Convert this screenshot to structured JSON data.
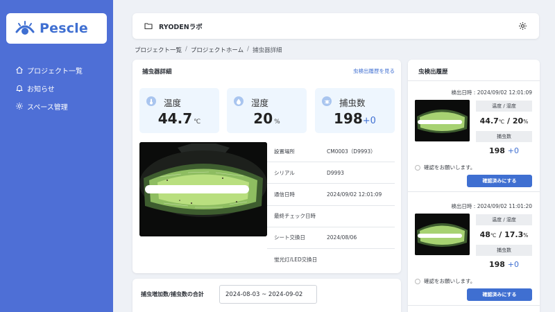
{
  "app": {
    "logo_text": "Pescle",
    "brand_color": "#4e6fd6",
    "accent_color": "#3f6fd1"
  },
  "sidebar": {
    "items": [
      {
        "label": "プロジェクト一覧",
        "icon": "home-icon"
      },
      {
        "label": "お知らせ",
        "icon": "bell-icon"
      },
      {
        "label": "スペース管理",
        "icon": "gear-icon"
      }
    ]
  },
  "header": {
    "title": "RYODENラボ"
  },
  "breadcrumb": [
    "プロジェクト一覧",
    "プロジェクトホーム",
    "捕虫器詳細"
  ],
  "detail": {
    "title": "捕虫器詳細",
    "link": "虫検出履歴を見る",
    "metrics": [
      {
        "label": "温度",
        "value": "44.7",
        "unit": "℃",
        "icon": "thermometer-icon"
      },
      {
        "label": "湿度",
        "value": "20",
        "unit": "%",
        "icon": "droplet-icon"
      },
      {
        "label": "捕虫数",
        "value": "198",
        "delta": "+0",
        "icon": "bug-icon"
      }
    ],
    "info": [
      {
        "key": "設置場所",
        "value": "CM0003（D9993）"
      },
      {
        "key": "シリアル",
        "value": "D9993"
      },
      {
        "key": "通信日時",
        "value": "2024/09/02 12:01:09"
      },
      {
        "key": "最終チェック日時",
        "value": ""
      },
      {
        "key": "シート交換日",
        "value": "2024/08/06"
      },
      {
        "key": "蛍光灯/LED交換日",
        "value": ""
      }
    ]
  },
  "summary": {
    "title": "捕虫増加数/捕虫数の合計",
    "date_range": "2024-08-03 ~ 2024-09-02"
  },
  "history": {
    "title": "虫検出履歴",
    "items": [
      {
        "timestamp": "検出日時 : 2024/09/02 12:01:09",
        "temp_humidity_label": "温度 / 湿度",
        "temp": "44.7",
        "temp_unit": "℃",
        "slash": " / ",
        "humidity": "20",
        "humidity_unit": "%",
        "count_label": "捕虫数",
        "count": "198",
        "delta": "+0",
        "check_text": "確認をお願いします。",
        "confirm_label": "確認済みにする"
      },
      {
        "timestamp": "検出日時 : 2024/09/02 11:01:20",
        "temp_humidity_label": "温度 / 湿度",
        "temp": "48",
        "temp_unit": "℃",
        "slash": " / ",
        "humidity": "17.3",
        "humidity_unit": "%",
        "count_label": "捕虫数",
        "count": "198",
        "delta": "+0",
        "check_text": "確認をお願いします。",
        "confirm_label": "確認済みにする"
      }
    ]
  }
}
